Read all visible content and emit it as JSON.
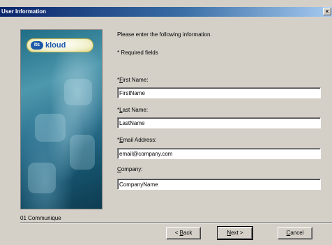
{
  "window": {
    "title": "User Information",
    "close_glyph": "×"
  },
  "banner": {
    "logo_mark": "its",
    "logo_text": "kloud"
  },
  "instructions": {
    "intro": "Please enter the following information.",
    "required_note": "* Required fields"
  },
  "form": {
    "first_name": {
      "asterisk": "*",
      "label_accel": "F",
      "label_rest": "irst Name:",
      "value": "FirstName"
    },
    "last_name": {
      "asterisk": "*",
      "label_accel": "L",
      "label_rest": "ast Name:",
      "value": "LastName"
    },
    "email": {
      "asterisk": "*",
      "label_accel": "E",
      "label_rest": "mail Address:",
      "value": "email@company.com"
    },
    "company": {
      "asterisk": "",
      "label_accel": "C",
      "label_rest": "ompany:",
      "value": "CompanyName"
    }
  },
  "footer": {
    "brand": "01 Communique"
  },
  "buttons": {
    "back": {
      "prefix": "< ",
      "accel": "B",
      "rest": "ack"
    },
    "next": {
      "prefix": "",
      "accel": "N",
      "rest": "ext >"
    },
    "cancel": {
      "accel": "C",
      "rest": "ancel"
    }
  }
}
